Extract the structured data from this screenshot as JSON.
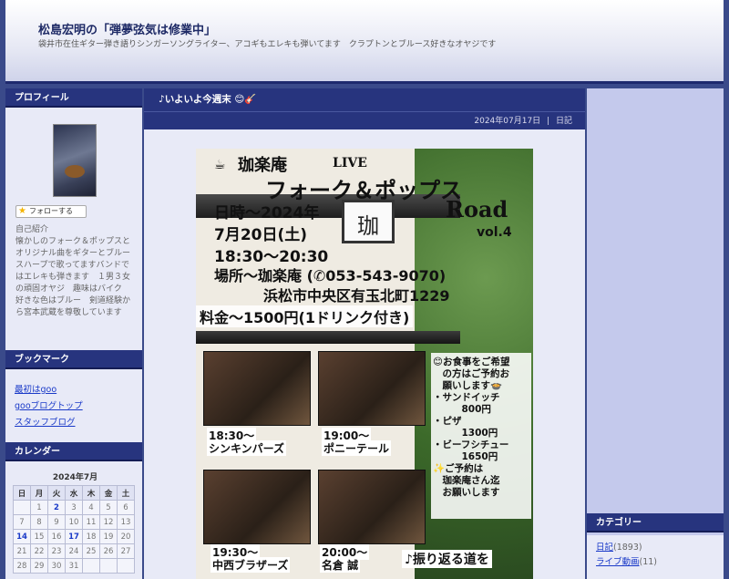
{
  "header": {
    "title": "松島宏明の「弾夢弦気は修業中」",
    "description": "袋井市在住ギター弾き語りシンガーソングライター、アコギもエレキも弾いてます　クラプトンとブルース好きなオヤジです"
  },
  "profile": {
    "heading": "プロフィール",
    "follow_label": "フォローする",
    "intro": "自己紹介\n懐かしのフォーク＆ポップスとオリジナル曲をギターとブルースハープで歌ってますバンドではエレキも弾きます　１男３女の頑固オヤジ　趣味はバイク　好きな色はブルー　剣道経験から宮本武蔵を尊敬しています"
  },
  "bookmarks": {
    "heading": "ブックマーク",
    "items": [
      "最初はgoo",
      "gooブログトップ",
      "スタッフブログ"
    ]
  },
  "calendar": {
    "heading": "カレンダー",
    "month": "2024年7月",
    "weekdays": [
      "日",
      "月",
      "火",
      "水",
      "木",
      "金",
      "土"
    ],
    "rows": [
      [
        "",
        "1",
        "2",
        "3",
        "4",
        "5",
        "6"
      ],
      [
        "7",
        "8",
        "9",
        "10",
        "11",
        "12",
        "13"
      ],
      [
        "14",
        "15",
        "16",
        "17",
        "18",
        "19",
        "20"
      ],
      [
        "21",
        "22",
        "23",
        "24",
        "25",
        "26",
        "27"
      ],
      [
        "28",
        "29",
        "30",
        "31",
        "",
        "",
        ""
      ]
    ],
    "bold_days": [
      "2",
      "14",
      "17"
    ]
  },
  "post": {
    "title": "♪いよいよ今週末 😊🎸",
    "date": "2024年07月17日",
    "separator": "|",
    "category": "日記"
  },
  "flyer": {
    "cup": "☕",
    "venue_name": "珈楽庵",
    "live": "LIVE",
    "event_title": "フォーク＆ポップス",
    "road": "Road",
    "vol": "vol.4",
    "date_line1": "日時〜2024年",
    "date_line2": "7月20日(土)",
    "time": "18:30〜20:30",
    "place": "場所〜珈楽庵 (✆053-543-9070)",
    "address": "浜松市中央区有玉北町1229",
    "price": "料金〜1500円(1ドリンク付き)",
    "sign_char": "珈",
    "acts": [
      {
        "time": "18:30〜",
        "name": "シンキンパーズ"
      },
      {
        "time": "19:00〜",
        "name": "ポニーテール"
      },
      {
        "time": "19:30〜",
        "name": "中西ブラザーズ"
      },
      {
        "time": "20:00〜",
        "name": "名倉 誠"
      }
    ],
    "menu": [
      "😊お食事をご希望",
      "　の方はご予約お",
      "　願いします🍲",
      "・サンドイッチ",
      "　　　800円",
      "・ピザ",
      "　　　1300円",
      "・ビーフシチュー",
      "　　　1650円",
      "✨ご予約は",
      "　珈楽庵さん迄",
      "　お願いします"
    ],
    "closing": "♪振り返る道を"
  },
  "category": {
    "heading": "カテゴリー",
    "items": [
      {
        "name": "日記",
        "count": "(1893)"
      },
      {
        "name": "ライブ動画",
        "count": "(11)"
      }
    ]
  }
}
